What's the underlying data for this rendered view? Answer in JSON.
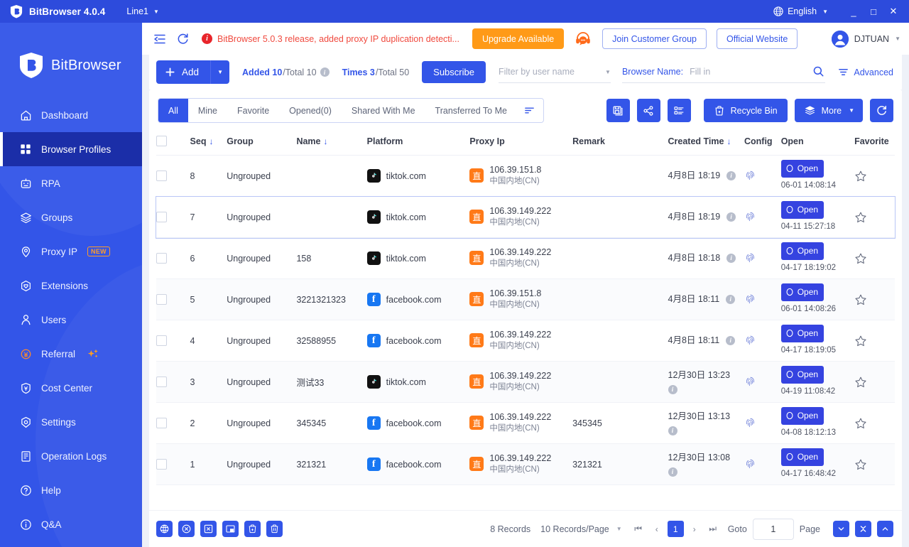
{
  "titlebar": {
    "app_name": "BitBrowser 4.0.4",
    "line": "Line1",
    "language": "English",
    "minimize": "_",
    "maximize": "□",
    "close": "✕"
  },
  "header": {
    "notice": "BitBrowser 5.0.3 release, added proxy IP duplication detecti...",
    "upgrade_label": "Upgrade Available",
    "join_group_label": "Join Customer Group",
    "official_site_label": "Official Website",
    "user_name": "DJTUAN"
  },
  "sidebar": {
    "brand": "BitBrowser",
    "items": [
      {
        "label": "Dashboard",
        "icon": "home-icon",
        "active": false
      },
      {
        "label": "Browser Profiles",
        "icon": "grid-icon",
        "active": true
      },
      {
        "label": "RPA",
        "icon": "robot-icon",
        "active": false
      },
      {
        "label": "Groups",
        "icon": "layers-icon",
        "active": false
      },
      {
        "label": "Proxy IP",
        "icon": "pin-icon",
        "active": false,
        "badge": "NEW"
      },
      {
        "label": "Extensions",
        "icon": "puzzle-icon",
        "active": false
      },
      {
        "label": "Users",
        "icon": "user-icon",
        "active": false
      },
      {
        "label": "Referral",
        "icon": "coin-icon",
        "active": false,
        "sparkle": true
      },
      {
        "label": "Cost Center",
        "icon": "shield-icon",
        "active": false
      },
      {
        "label": "Settings",
        "icon": "gear-icon",
        "active": false
      },
      {
        "label": "Operation Logs",
        "icon": "log-icon",
        "active": false
      },
      {
        "label": "Help",
        "icon": "question-icon",
        "active": false
      },
      {
        "label": "Q&A",
        "icon": "info-icon",
        "active": false
      }
    ]
  },
  "toolbar": {
    "add_label": "Add",
    "added_bold": "Added 10",
    "added_rest": "/Total 10",
    "times_bold": "Times 3",
    "times_rest": "/Total 50",
    "subscribe_label": "Subscribe",
    "user_filter_placeholder": "Filter by user name",
    "browser_name_label": "Browser Name:",
    "browser_name_placeholder": "Fill in",
    "browser_name_value": "",
    "advanced_label": "Advanced"
  },
  "tabs": [
    {
      "label": "All",
      "active": true
    },
    {
      "label": "Mine",
      "active": false
    },
    {
      "label": "Favorite",
      "active": false
    },
    {
      "label": "Opened(0)",
      "active": false
    },
    {
      "label": "Shared With Me",
      "active": false
    },
    {
      "label": "Transferred To Me",
      "active": false
    }
  ],
  "actions": {
    "save_label": "save-icon",
    "share_label": "share-icon",
    "columns_label": "columns-icon",
    "recycle_bin_label": "Recycle Bin",
    "more_label": "More",
    "refresh_label": "refresh-icon"
  },
  "table": {
    "columns": [
      "Seq",
      "Group",
      "Name",
      "Platform",
      "Proxy Ip",
      "Remark",
      "Created Time",
      "Config",
      "Open",
      "Favorite"
    ],
    "rows": [
      {
        "seq": "8",
        "group": "Ungrouped",
        "name": "",
        "platform": "tiktok.com",
        "platform_icon": "tiktok-icon",
        "proxy_ip": "106.39.151.8",
        "proxy_loc": "中国内地(CN)",
        "proxy_badge": "直",
        "remark": "",
        "created": "4月8日 18:19",
        "open_label": "Open",
        "open_time": "06-01 14:08:14",
        "selected": false
      },
      {
        "seq": "7",
        "group": "Ungrouped",
        "name": "",
        "platform": "tiktok.com",
        "platform_icon": "tiktok-icon",
        "proxy_ip": "106.39.149.222",
        "proxy_loc": "中国内地(CN)",
        "proxy_badge": "直",
        "remark": "",
        "created": "4月8日 18:19",
        "open_label": "Open",
        "open_time": "04-11 15:27:18",
        "selected": true
      },
      {
        "seq": "6",
        "group": "Ungrouped",
        "name": "158",
        "platform": "tiktok.com",
        "platform_icon": "tiktok-icon",
        "proxy_ip": "106.39.149.222",
        "proxy_loc": "中国内地(CN)",
        "proxy_badge": "直",
        "remark": "",
        "created": "4月8日 18:18",
        "open_label": "Open",
        "open_time": "04-17 18:19:02",
        "selected": false
      },
      {
        "seq": "5",
        "group": "Ungrouped",
        "name": "3221321323",
        "platform": "facebook.com",
        "platform_icon": "facebook-icon",
        "proxy_ip": "106.39.151.8",
        "proxy_loc": "中国内地(CN)",
        "proxy_badge": "直",
        "remark": "",
        "created": "4月8日 18:11",
        "open_label": "Open",
        "open_time": "06-01 14:08:26",
        "selected": false
      },
      {
        "seq": "4",
        "group": "Ungrouped",
        "name": "32588955",
        "platform": "facebook.com",
        "platform_icon": "facebook-icon",
        "proxy_ip": "106.39.149.222",
        "proxy_loc": "中国内地(CN)",
        "proxy_badge": "直",
        "remark": "",
        "created": "4月8日 18:11",
        "open_label": "Open",
        "open_time": "04-17 18:19:05",
        "selected": false
      },
      {
        "seq": "3",
        "group": "Ungrouped",
        "name": "测试33",
        "platform": "tiktok.com",
        "platform_icon": "tiktok-icon",
        "proxy_ip": "106.39.149.222",
        "proxy_loc": "中国内地(CN)",
        "proxy_badge": "直",
        "remark": "",
        "created": "12月30日 13:23",
        "open_label": "Open",
        "open_time": "04-19 11:08:42",
        "selected": false
      },
      {
        "seq": "2",
        "group": "Ungrouped",
        "name": "345345",
        "platform": "facebook.com",
        "platform_icon": "facebook-icon",
        "proxy_ip": "106.39.149.222",
        "proxy_loc": "中国内地(CN)",
        "proxy_badge": "直",
        "remark": "345345",
        "created": "12月30日 13:13",
        "open_label": "Open",
        "open_time": "04-08 18:12:13",
        "selected": false
      },
      {
        "seq": "1",
        "group": "Ungrouped",
        "name": "321321",
        "platform": "facebook.com",
        "platform_icon": "facebook-icon",
        "proxy_ip": "106.39.149.222",
        "proxy_loc": "中国内地(CN)",
        "proxy_badge": "直",
        "remark": "321321",
        "created": "12月30日 13:08",
        "open_label": "Open",
        "open_time": "04-17 16:48:42",
        "selected": false
      }
    ]
  },
  "footer": {
    "records": "8 Records",
    "per_page": "10 Records/Page",
    "current_page": "1",
    "goto_label": "Goto",
    "goto_value": "1",
    "page_word": "Page"
  },
  "colors": {
    "brand_blue": "#3355e8",
    "title_blue": "#2d4bdc",
    "active_nav": "#1b2ea8",
    "orange": "#ff9a17",
    "notice_red": "#f04a3f",
    "proxy_orange": "#ff7a18"
  }
}
